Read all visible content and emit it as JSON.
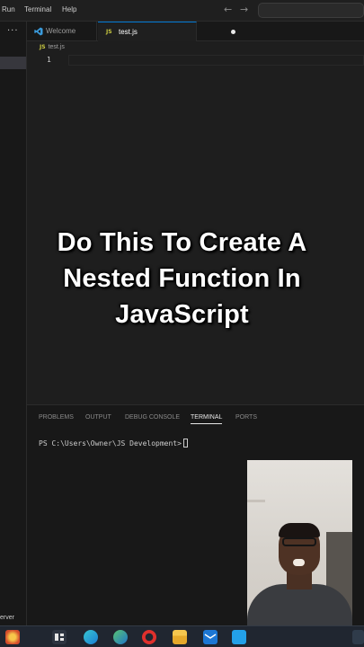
{
  "menu": {
    "items": [
      "Run",
      "Terminal",
      "Help"
    ],
    "back_arrow": "←",
    "forward_arrow": "→"
  },
  "sidebar": {
    "more_icon": "···"
  },
  "tabs": [
    {
      "label": "Welcome",
      "icon": "vscode-icon",
      "active": false
    },
    {
      "label": "test.js",
      "icon": "js-file-icon",
      "active": true,
      "unsaved": true
    }
  ],
  "editor": {
    "breadcrumb": "test.js",
    "line_number": "1",
    "file_badge": "JS"
  },
  "caption": "Do This To Create A Nested Function In JavaScript",
  "panel": {
    "tabs": [
      "PROBLEMS",
      "OUTPUT",
      "DEBUG CONSOLE",
      "TERMINAL",
      "PORTS"
    ],
    "active_tab": "TERMINAL",
    "prompt": "PS C:\\Users\\Owner\\JS Development>"
  },
  "statusbar": {
    "text": "erver"
  },
  "colors": {
    "editor_bg": "#1e1e1e",
    "accent": "#0078d4",
    "js_yellow": "#cbcb41"
  },
  "taskbar_icons": [
    "app-icon",
    "task-view-icon",
    "edge-icon",
    "edge-dev-icon",
    "opera-icon",
    "file-explorer-icon",
    "mail-icon",
    "vscode-taskbar-icon"
  ]
}
